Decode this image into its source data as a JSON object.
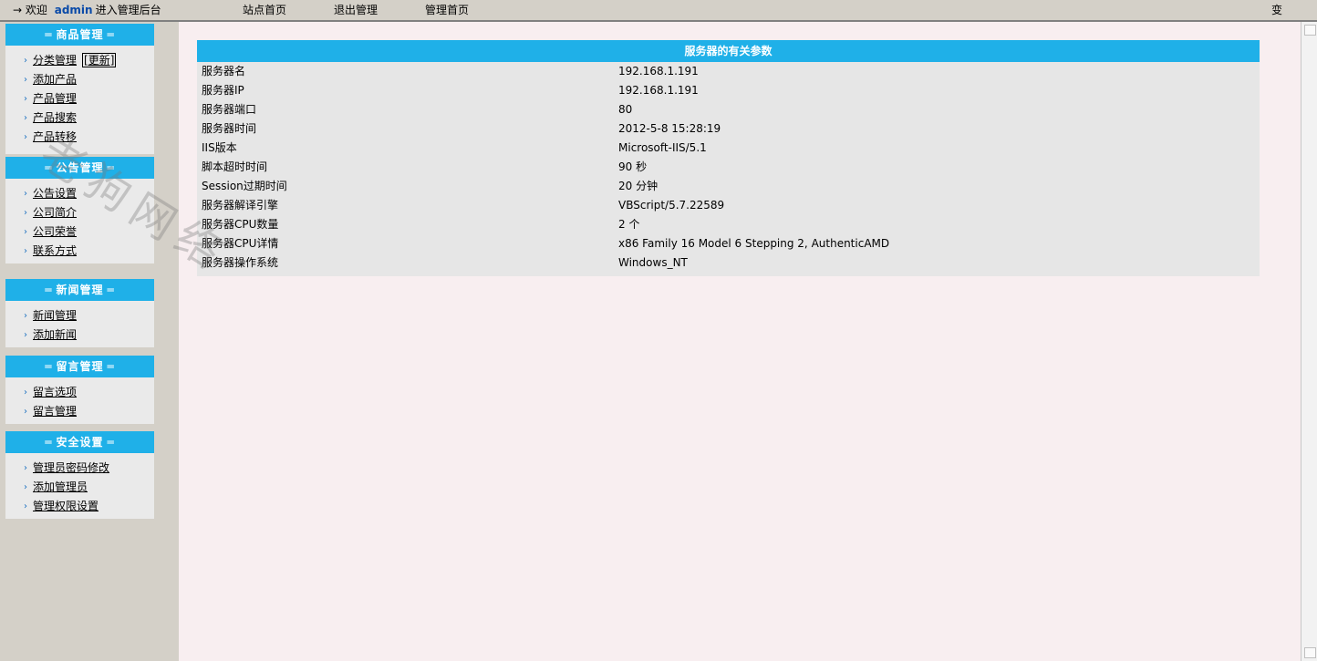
{
  "topbar": {
    "arrow": "→",
    "welcome_prefix": "欢迎",
    "username": "admin",
    "welcome_suffix": "进入管理后台",
    "nav_site": "站点首页",
    "nav_logout": "退出管理",
    "nav_admin": "管理首页",
    "right_text": "变"
  },
  "sidebar": {
    "panels": [
      {
        "title": "商品管理",
        "items": [
          "分类管理",
          "添加产品",
          "产品管理",
          "产品搜索",
          "产品转移"
        ],
        "extra": "[更新]"
      },
      {
        "title": "公告管理",
        "items": [
          "公告设置",
          "公司简介",
          "公司荣誉",
          "联系方式"
        ]
      },
      {
        "title": "新闻管理",
        "items": [
          "新闻管理",
          "添加新闻"
        ]
      },
      {
        "title": "留言管理",
        "items": [
          "留言选项",
          "留言管理"
        ]
      },
      {
        "title": "安全设置",
        "items": [
          "管理员密码修改",
          "添加管理员",
          "管理权限设置"
        ]
      }
    ],
    "title_deco": "═"
  },
  "server_info": {
    "title": "服务器的有关参数",
    "rows": [
      {
        "k": "服务器名",
        "v": "192.168.1.191"
      },
      {
        "k": "服务器IP",
        "v": "192.168.1.191"
      },
      {
        "k": "服务器端口",
        "v": "80"
      },
      {
        "k": "服务器时间",
        "v": "2012-5-8 15:28:19"
      },
      {
        "k": "IIS版本",
        "v": "Microsoft-IIS/5.1"
      },
      {
        "k": "脚本超时时间",
        "v": "90 秒"
      },
      {
        "k": "Session过期时间",
        "v": "20 分钟"
      },
      {
        "k": "服务器解译引擎",
        "v": "VBScript/5.7.22589"
      },
      {
        "k": "服务器CPU数量",
        "v": "2 个"
      },
      {
        "k": "服务器CPU详情",
        "v": "x86 Family 16 Model 6 Stepping 2, AuthenticAMD"
      },
      {
        "k": "服务器操作系统",
        "v": "Windows_NT"
      }
    ]
  },
  "watermark": "老狗网络",
  "colors": {
    "accent": "#1fb0e8",
    "main_bg": "#f8eef0",
    "panel_bg": "#eaeaea",
    "chrome": "#d4d0c8"
  }
}
